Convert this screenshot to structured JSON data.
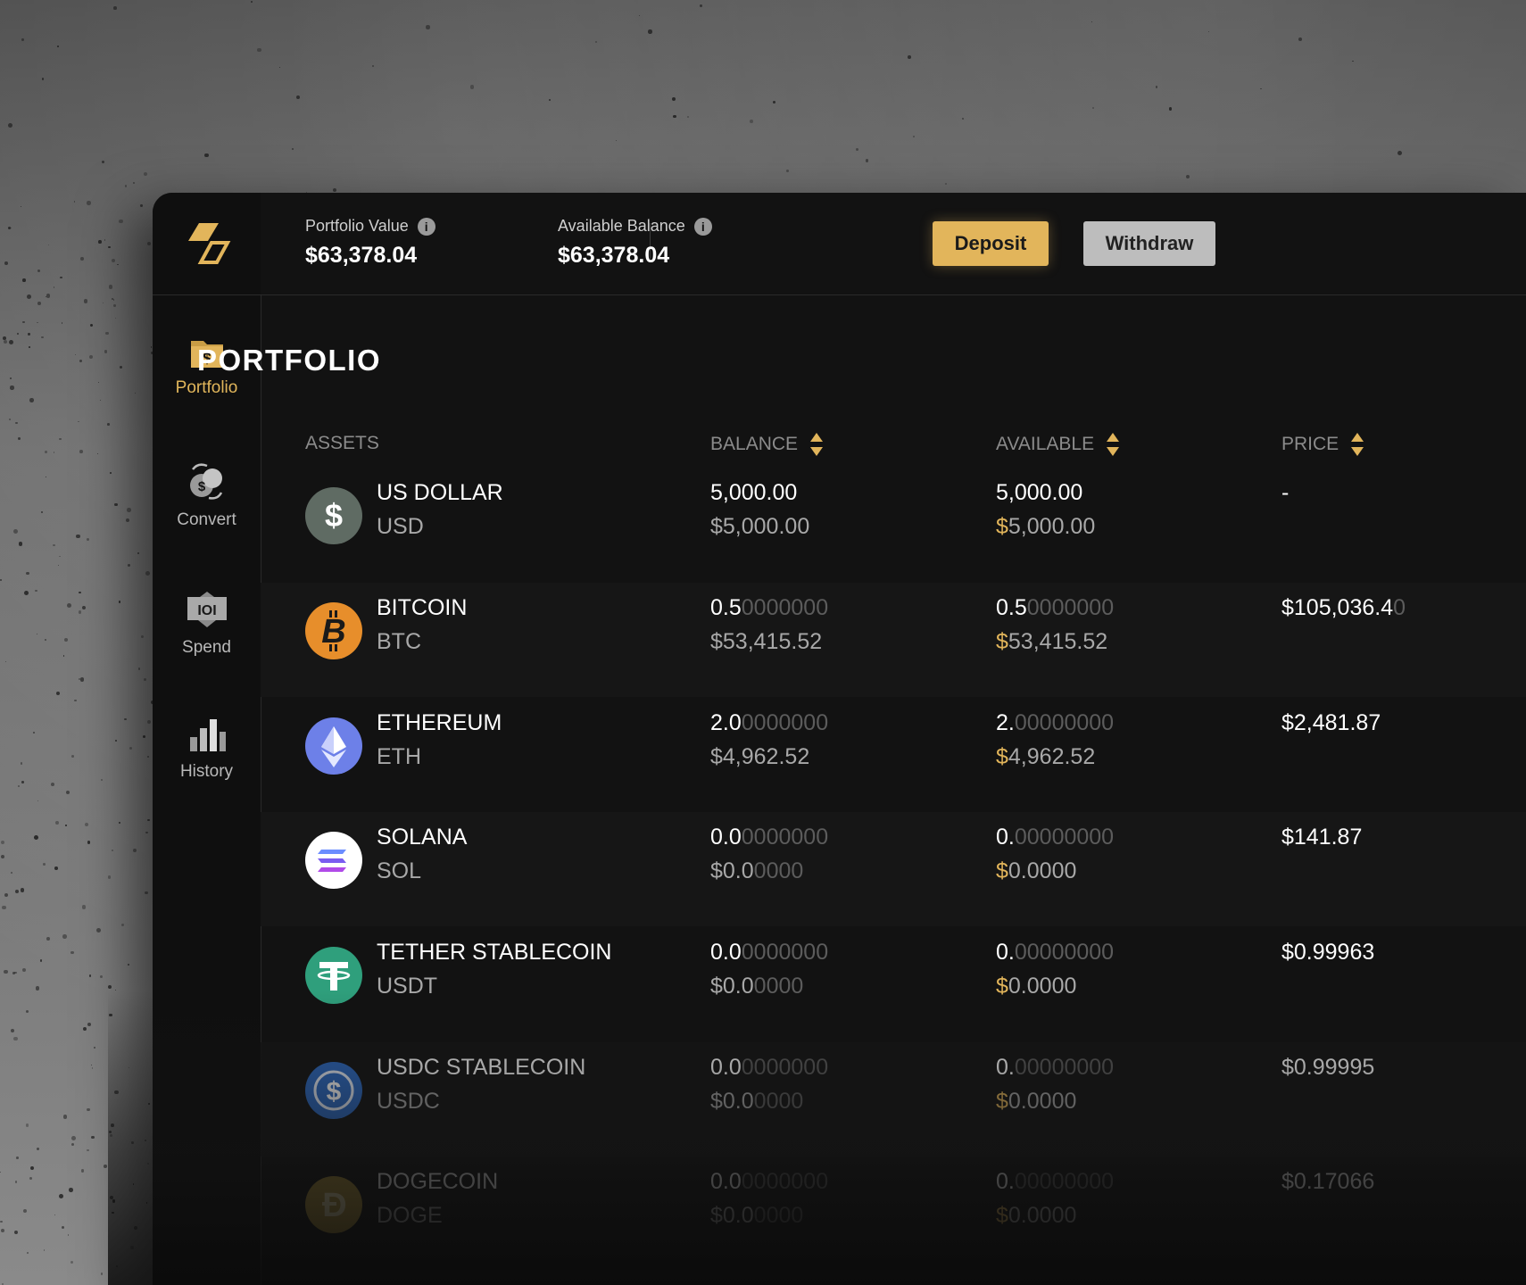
{
  "header": {
    "portfolio_value_label": "Portfolio Value",
    "portfolio_value": "$63,378.04",
    "available_balance_label": "Available Balance",
    "available_balance": "$63,378.04",
    "info_glyph": "i",
    "deposit_label": "Deposit",
    "withdraw_label": "Withdraw"
  },
  "sidebar": {
    "items": [
      {
        "label": "Portfolio",
        "icon": "wallet-dollar-icon",
        "active": true
      },
      {
        "label": "Convert",
        "icon": "convert-coins-icon",
        "active": false
      },
      {
        "label": "Spend",
        "icon": "spend-card-icon",
        "active": false
      },
      {
        "label": "History",
        "icon": "bar-chart-icon",
        "active": false
      }
    ]
  },
  "main": {
    "title": "PORTFOLIO",
    "columns": {
      "assets": "ASSETS",
      "balance": "BALANCE",
      "available": "AVAILABLE",
      "price": "PRICE"
    }
  },
  "assets": [
    {
      "name": "US DOLLAR",
      "symbol": "USD",
      "bal_main": "5,000.00",
      "bal_dim": "",
      "bal_usd_main": "$5,000.00",
      "bal_usd_dim": "",
      "av_main": "5,000.00",
      "av_dim": "",
      "av_usd_main": "$5,000.00",
      "av_usd_dim": "",
      "price_main": "-",
      "price_dim": "",
      "icon_glyph": "$",
      "color": "#5f6b63"
    },
    {
      "name": "BITCOIN",
      "symbol": "BTC",
      "bal_main": "0.5",
      "bal_dim": "0000000",
      "bal_usd_main": "$53,415.52",
      "bal_usd_dim": "",
      "av_main": "0.5",
      "av_dim": "0000000",
      "av_usd_main": "$53,415.52",
      "av_usd_dim": "",
      "price_main": "$105,036.4",
      "price_dim": "0",
      "icon_glyph": "B",
      "color": "#e78e2b"
    },
    {
      "name": "ETHEREUM",
      "symbol": "ETH",
      "bal_main": "2.0",
      "bal_dim": "0000000",
      "bal_usd_main": "$4,962.52",
      "bal_usd_dim": "",
      "av_main": "2.",
      "av_dim": "00000000",
      "av_usd_main": "$4,962.52",
      "av_usd_dim": "",
      "price_main": "$2,481.87",
      "price_dim": "",
      "icon_glyph": "",
      "color": "#6d80e8"
    },
    {
      "name": "SOLANA",
      "symbol": "SOL",
      "bal_main": "0.0",
      "bal_dim": "0000000",
      "bal_usd_main": "$0.0",
      "bal_usd_dim": "0000",
      "av_main": "0.",
      "av_dim": "00000000",
      "av_usd_main": "$0.0000",
      "av_usd_dim": "",
      "price_main": "$141.87",
      "price_dim": "",
      "icon_glyph": "",
      "color": "#ffffff"
    },
    {
      "name": "TETHER STABLECOIN",
      "symbol": "USDT",
      "bal_main": "0.0",
      "bal_dim": "0000000",
      "bal_usd_main": "$0.0",
      "bal_usd_dim": "0000",
      "av_main": "0.",
      "av_dim": "00000000",
      "av_usd_main": "$0.0000",
      "av_usd_dim": "",
      "price_main": "$0.99963",
      "price_dim": "",
      "icon_glyph": "T",
      "color": "#2f9f7c"
    },
    {
      "name": "USDC STABLECOIN",
      "symbol": "USDC",
      "bal_main": "0.0",
      "bal_dim": "0000000",
      "bal_usd_main": "$0.0",
      "bal_usd_dim": "0000",
      "av_main": "0.",
      "av_dim": "00000000",
      "av_usd_main": "$0.0000",
      "av_usd_dim": "",
      "price_main": "$0.99995",
      "price_dim": "",
      "icon_glyph": "$",
      "color": "#2f6bc2"
    },
    {
      "name": "DOGECOIN",
      "symbol": "DOGE",
      "bal_main": "0.0",
      "bal_dim": "0000000",
      "bal_usd_main": "$0.0",
      "bal_usd_dim": "0000",
      "av_main": "0.",
      "av_dim": "00000000",
      "av_usd_main": "$0.0000",
      "av_usd_dim": "",
      "price_main": "$0.17066",
      "price_dim": "",
      "icon_glyph": "D",
      "color": "#b89a3a"
    }
  ],
  "colors": {
    "accent": "#e2b55b",
    "background": "#121212"
  }
}
